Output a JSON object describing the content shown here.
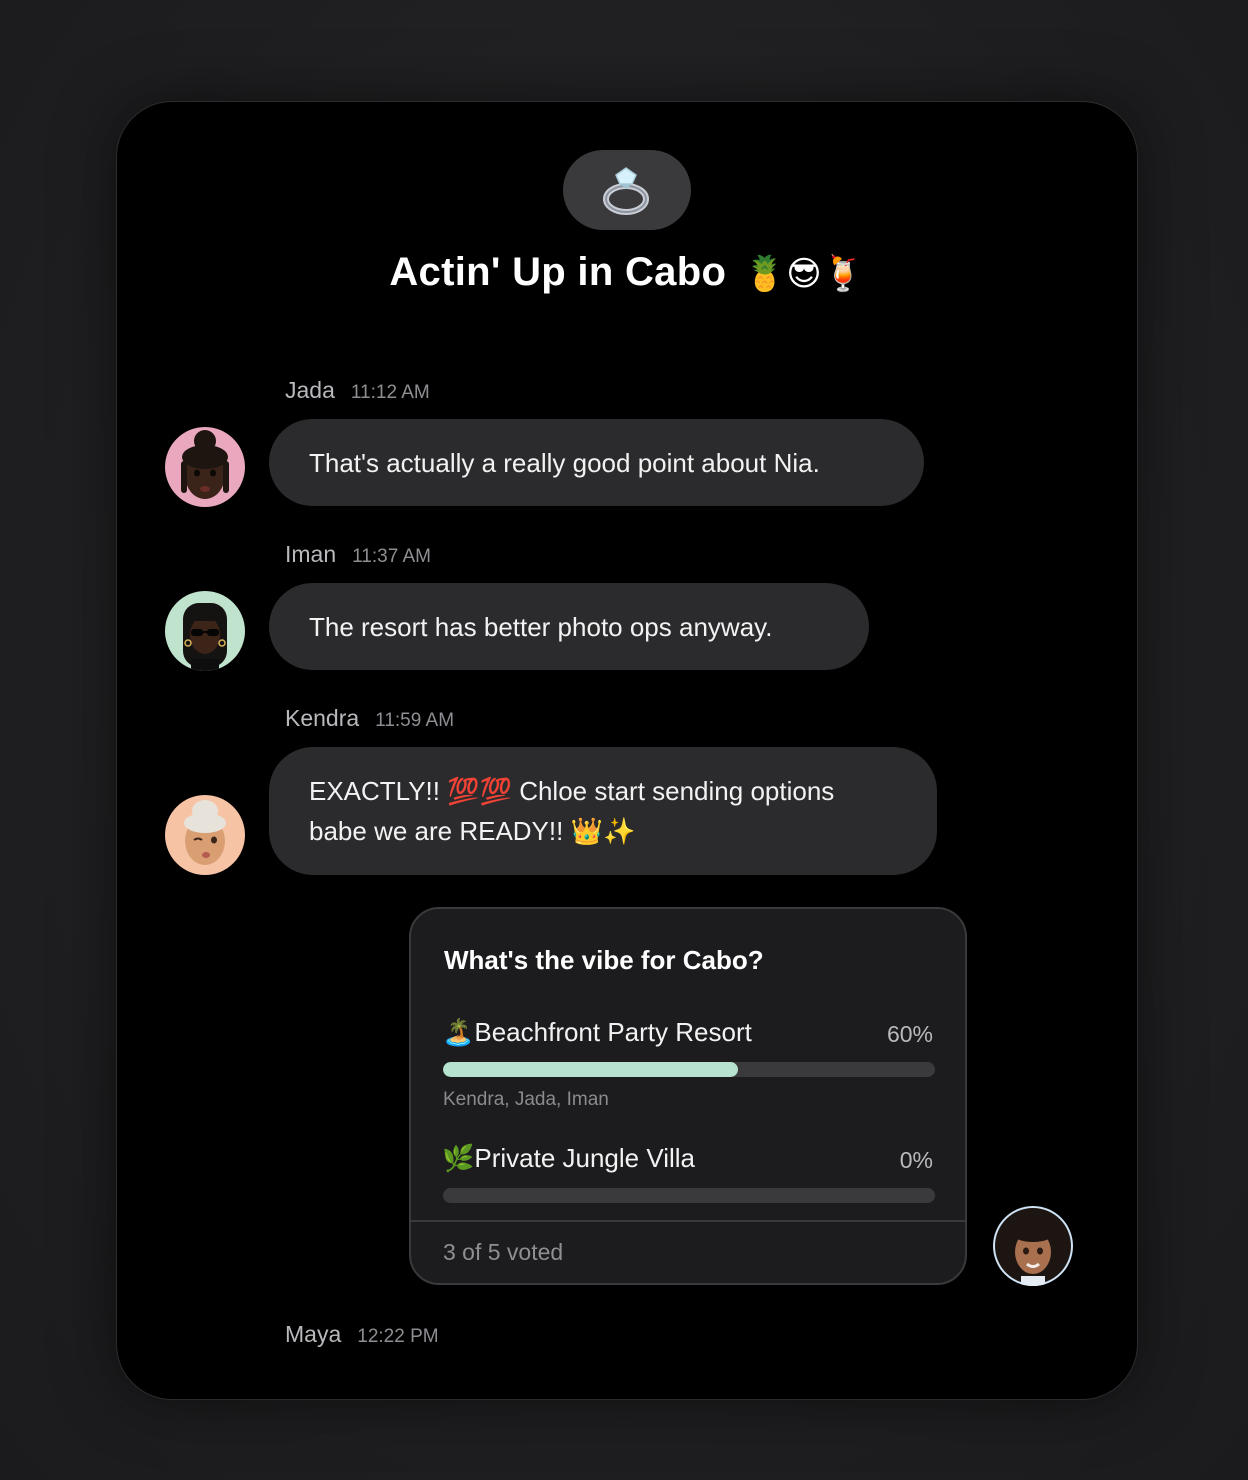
{
  "chat": {
    "group_icon": "ring-icon",
    "group_emoji": "💍",
    "title": "Actin' Up in Cabo",
    "title_emojis": "🍍😎🍹"
  },
  "messages": [
    {
      "name": "Jada",
      "time": "11:12 AM",
      "text": "That's actually a really good point about Nia.",
      "avatar_color": "#eaa8bf"
    },
    {
      "name": "Iman",
      "time": "11:37 AM",
      "text": "The resort has better photo ops anyway.",
      "avatar_color": "#bfe3cc"
    },
    {
      "name": "Kendra",
      "time": "11:59 AM",
      "line1": "EXACTLY!! 💯💯 Chloe start sending options",
      "line2": "babe we are READY!! 👑✨",
      "avatar_color": "#f6c3a5"
    }
  ],
  "poll": {
    "question": "What's the vibe for Cabo?",
    "options": [
      {
        "label": "🏝️Beachfront Party Resort",
        "percent_label": "60%",
        "percent": 60,
        "voters": "Kendra, Jada, Iman"
      },
      {
        "label": "🌿Private Jungle Villa",
        "percent_label": "0%",
        "percent": 0
      }
    ],
    "footer": "3 of 5 voted",
    "accent": "#b6e2cf"
  },
  "current_sender": {
    "name": "Maya",
    "time": "12:22 PM",
    "avatar_color": "#cfe3f5"
  }
}
